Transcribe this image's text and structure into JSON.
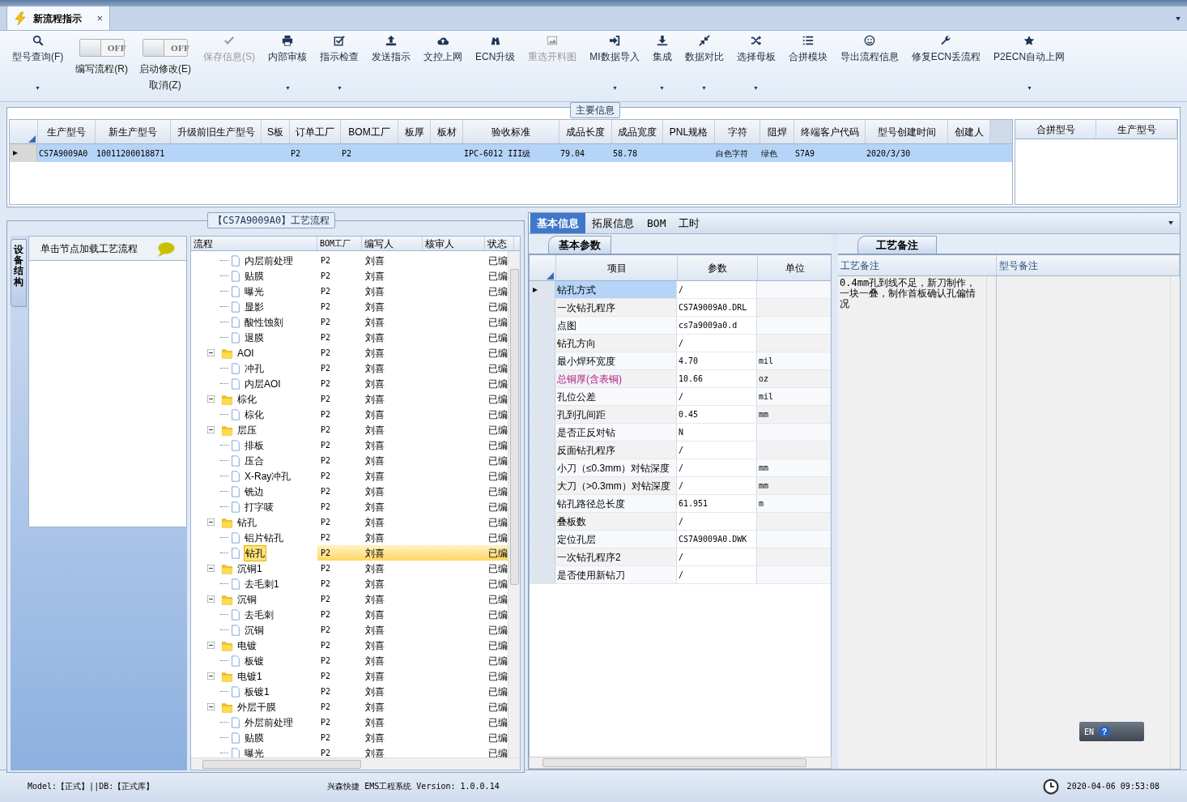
{
  "window_tab": {
    "title": "新流程指示",
    "close": "×",
    "selected": true
  },
  "toolbar": [
    {
      "kind": "button",
      "label": "型号查询(F)",
      "disabled": false,
      "dropdown": true
    },
    {
      "kind": "toggle",
      "label": "编写流程(R)",
      "toggle_text": "OFF",
      "on": false
    },
    {
      "kind": "toggle",
      "label": "启动修改(E)",
      "sublabel": "取消(Z)",
      "toggle_text": "OFF",
      "on": false
    },
    {
      "kind": "button",
      "label": "保存信息(S)",
      "disabled": true,
      "dropdown": false
    },
    {
      "kind": "button",
      "label": "内部审核",
      "disabled": false,
      "dropdown": true
    },
    {
      "kind": "button",
      "label": "指示检查",
      "disabled": false,
      "dropdown": true
    },
    {
      "kind": "button",
      "label": "发送指示",
      "disabled": false,
      "dropdown": false
    },
    {
      "kind": "button",
      "label": "文控上网",
      "disabled": false,
      "dropdown": false
    },
    {
      "kind": "button",
      "label": "ECN升级",
      "disabled": false,
      "dropdown": false
    },
    {
      "kind": "button",
      "label": "重选开料图",
      "disabled": true,
      "dropdown": false
    },
    {
      "kind": "button",
      "label": "MI数据导入",
      "disabled": false,
      "dropdown": true
    },
    {
      "kind": "button",
      "label": "集成",
      "disabled": false,
      "dropdown": true
    },
    {
      "kind": "button",
      "label": "数据对比",
      "disabled": false,
      "dropdown": true
    },
    {
      "kind": "button",
      "label": "选择母板",
      "disabled": false,
      "dropdown": true
    },
    {
      "kind": "button",
      "label": "合拼模块",
      "disabled": false,
      "dropdown": false
    },
    {
      "kind": "button",
      "label": "导出流程信息",
      "disabled": false,
      "dropdown": false
    },
    {
      "kind": "button",
      "label": "修复ECN丢流程",
      "disabled": false,
      "dropdown": false
    },
    {
      "kind": "button",
      "label": "P2ECN自动上网",
      "disabled": false,
      "dropdown": true
    }
  ],
  "main_info": {
    "title": "主要信息",
    "columns": [
      "生产型号",
      "新生产型号",
      "升级前旧生产型号",
      "S板",
      "订单工厂",
      "BOM工厂",
      "板厚",
      "板材",
      "验收标准",
      "成品长度",
      "成品宽度",
      "PNL规格",
      "字符",
      "阻焊",
      "终端客户代码",
      "型号创建时间",
      "创建人"
    ],
    "rows": [
      {
        "selected": true,
        "cells": [
          "CS7A9009A0",
          "10011200018871",
          null,
          null,
          "P2",
          "P2",
          null,
          null,
          "IPC-6012 III级",
          "79.04",
          "58.78",
          null,
          "白色字符",
          "绿色",
          "S7A9",
          "2020/3/30",
          null
        ]
      }
    ],
    "merge_table": {
      "columns": [
        "合拼型号",
        "生产型号"
      ]
    }
  },
  "side_panel": {
    "tab": "设备结构",
    "hint": "单击节点加载工艺流程"
  },
  "process": {
    "title": "【CS7A9009A0】工艺流程",
    "columns": [
      "流程",
      "BOM工厂",
      "编写人",
      "核审人",
      "状态"
    ],
    "tree": [
      {
        "kind": "group",
        "children": [
          {
            "kind": "step",
            "label": "内层前处理",
            "bom": "P2",
            "writer": "刘喜",
            "status": "已编",
            "selected": false
          },
          {
            "kind": "step",
            "label": "贴膜",
            "bom": "P2",
            "writer": "刘喜",
            "status": "已编",
            "selected": false
          },
          {
            "kind": "step",
            "label": "曝光",
            "bom": "P2",
            "writer": "刘喜",
            "status": "已编",
            "selected": false
          },
          {
            "kind": "step",
            "label": "显影",
            "bom": "P2",
            "writer": "刘喜",
            "status": "已编",
            "selected": false
          },
          {
            "kind": "step",
            "label": "酸性蚀刻",
            "bom": "P2",
            "writer": "刘喜",
            "status": "已编",
            "selected": false
          },
          {
            "kind": "step",
            "label": "退膜",
            "bom": "P2",
            "writer": "刘喜",
            "status": "已编",
            "selected": false
          }
        ]
      },
      {
        "kind": "folder",
        "label": "AOI",
        "bom": "P2",
        "writer": "刘喜",
        "status": "已编",
        "selected": false,
        "expanded": true,
        "children": [
          {
            "kind": "step",
            "label": "冲孔",
            "bom": "P2",
            "writer": "刘喜",
            "status": "已编",
            "selected": false
          },
          {
            "kind": "step",
            "label": "内层AOI",
            "bom": "P2",
            "writer": "刘喜",
            "status": "已编",
            "selected": false
          }
        ]
      },
      {
        "kind": "folder",
        "label": "棕化",
        "bom": "P2",
        "writer": "刘喜",
        "status": "已编",
        "selected": false,
        "expanded": true,
        "children": [
          {
            "kind": "step",
            "label": "棕化",
            "bom": "P2",
            "writer": "刘喜",
            "status": "已编",
            "selected": false
          }
        ]
      },
      {
        "kind": "folder",
        "label": "层压",
        "bom": "P2",
        "writer": "刘喜",
        "status": "已编",
        "selected": false,
        "expanded": true,
        "children": [
          {
            "kind": "step",
            "label": "排板",
            "bom": "P2",
            "writer": "刘喜",
            "status": "已编",
            "selected": false
          },
          {
            "kind": "step",
            "label": "压合",
            "bom": "P2",
            "writer": "刘喜",
            "status": "已编",
            "selected": false
          },
          {
            "kind": "step",
            "label": "X-Ray冲孔",
            "bom": "P2",
            "writer": "刘喜",
            "status": "已编",
            "selected": false
          },
          {
            "kind": "step",
            "label": "铣边",
            "bom": "P2",
            "writer": "刘喜",
            "status": "已编",
            "selected": false
          },
          {
            "kind": "step",
            "label": "打字唛",
            "bom": "P2",
            "writer": "刘喜",
            "status": "已编",
            "selected": false
          }
        ]
      },
      {
        "kind": "folder",
        "label": "钻孔",
        "bom": "P2",
        "writer": "刘喜",
        "status": "已编",
        "selected": false,
        "expanded": true,
        "children": [
          {
            "kind": "step",
            "label": "铝片钻孔",
            "bom": "P2",
            "writer": "刘喜",
            "status": "已编",
            "selected": false
          },
          {
            "kind": "step",
            "label": "钻孔",
            "bom": "P2",
            "writer": "刘喜",
            "status": "已编",
            "selected": true
          }
        ]
      },
      {
        "kind": "folder",
        "label": "沉铜1",
        "bom": "P2",
        "writer": "刘喜",
        "status": "已编",
        "selected": false,
        "expanded": true,
        "children": [
          {
            "kind": "step",
            "label": "去毛刺1",
            "bom": "P2",
            "writer": "刘喜",
            "status": "已编",
            "selected": false
          }
        ]
      },
      {
        "kind": "folder",
        "label": "沉铜",
        "bom": "P2",
        "writer": "刘喜",
        "status": "已编",
        "selected": false,
        "expanded": true,
        "children": [
          {
            "kind": "step",
            "label": "去毛刺",
            "bom": "P2",
            "writer": "刘喜",
            "status": "已编",
            "selected": false
          },
          {
            "kind": "step",
            "label": "沉铜",
            "bom": "P2",
            "writer": "刘喜",
            "status": "已编",
            "selected": false
          }
        ]
      },
      {
        "kind": "folder",
        "label": "电镀",
        "bom": "P2",
        "writer": "刘喜",
        "status": "已编",
        "selected": false,
        "expanded": true,
        "children": [
          {
            "kind": "step",
            "label": "板镀",
            "bom": "P2",
            "writer": "刘喜",
            "status": "已编",
            "selected": false
          }
        ]
      },
      {
        "kind": "folder",
        "label": "电镀1",
        "bom": "P2",
        "writer": "刘喜",
        "status": "已编",
        "selected": false,
        "expanded": true,
        "children": [
          {
            "kind": "step",
            "label": "板镀1",
            "bom": "P2",
            "writer": "刘喜",
            "status": "已编",
            "selected": false
          }
        ]
      },
      {
        "kind": "folder",
        "label": "外层干膜",
        "bom": "P2",
        "writer": "刘喜",
        "status": "已编",
        "selected": false,
        "expanded": true,
        "children": [
          {
            "kind": "step",
            "label": "外层前处理",
            "bom": "P2",
            "writer": "刘喜",
            "status": "已编",
            "selected": false
          },
          {
            "kind": "step",
            "label": "贴膜",
            "bom": "P2",
            "writer": "刘喜",
            "status": "已编",
            "selected": false
          },
          {
            "kind": "step",
            "label": "曝光",
            "bom": "P2",
            "writer": "刘喜",
            "status": "已编",
            "selected": false
          }
        ]
      }
    ]
  },
  "detail_tabs": [
    {
      "label": "基本信息",
      "selected": true
    },
    {
      "label": "拓展信息",
      "selected": false
    },
    {
      "label": "BOM",
      "selected": false
    },
    {
      "label": "工时",
      "selected": false
    }
  ],
  "params": {
    "tab": "基本参数",
    "columns": [
      "项目",
      "参数",
      "单位"
    ],
    "rows": [
      {
        "item": "钻孔方式",
        "value": "/",
        "selected": true,
        "emphasis": false
      },
      {
        "item": "一次钻孔程序",
        "value": "CS7A9009A0.DRL",
        "selected": false,
        "emphasis": false
      },
      {
        "item": "点图",
        "value": "cs7a9009a0.d",
        "selected": false,
        "emphasis": false
      },
      {
        "item": "钻孔方向",
        "value": "/",
        "selected": false,
        "emphasis": false
      },
      {
        "item": "最小焊环宽度",
        "value": "4.70",
        "unit": "mil",
        "selected": false,
        "emphasis": false
      },
      {
        "item": "总铜厚(含表铜)",
        "value": "10.66",
        "unit": "oz",
        "selected": false,
        "emphasis": true
      },
      {
        "item": "孔位公差",
        "value": "/",
        "unit": "mil",
        "selected": false,
        "emphasis": false
      },
      {
        "item": "孔到孔间距",
        "value": "0.45",
        "unit": "mm",
        "selected": false,
        "emphasis": false
      },
      {
        "item": "是否正反对钻",
        "value": "N",
        "selected": false,
        "emphasis": false
      },
      {
        "item": "反面钻孔程序",
        "value": "/",
        "selected": false,
        "emphasis": false
      },
      {
        "item": "小刀（≤0.3mm）对钻深度",
        "value": "/",
        "unit": "mm",
        "selected": false,
        "emphasis": false
      },
      {
        "item": "大刀（>0.3mm）对钻深度",
        "value": "/",
        "unit": "mm",
        "selected": false,
        "emphasis": false
      },
      {
        "item": "钻孔路径总长度",
        "value": "61.951",
        "unit": "m",
        "selected": false,
        "emphasis": false
      },
      {
        "item": "叠板数",
        "value": "/",
        "selected": false,
        "emphasis": false
      },
      {
        "item": "定位孔层",
        "value": "CS7A9009A0.DWK",
        "selected": false,
        "emphasis": false
      },
      {
        "item": "一次钻孔程序2",
        "value": "/",
        "selected": false,
        "emphasis": false
      },
      {
        "item": "是否使用新钻刀",
        "value": "/",
        "selected": false,
        "emphasis": false
      }
    ]
  },
  "remarks": {
    "tab": "工艺备注",
    "columns": [
      "工艺备注",
      "型号备注"
    ],
    "process_remark": "0.4mm孔到线不足，新刀制作，一块一叠，制作首板确认孔偏情况"
  },
  "ime": {
    "label": "EN",
    "help": "?"
  },
  "status_bar": {
    "model": "Model:【正式】||DB:【正式库】",
    "app": "兴森快捷 EMS工程系统 Version: 1.0.0.14",
    "datetime": "2020-04-06 09:53:08"
  }
}
